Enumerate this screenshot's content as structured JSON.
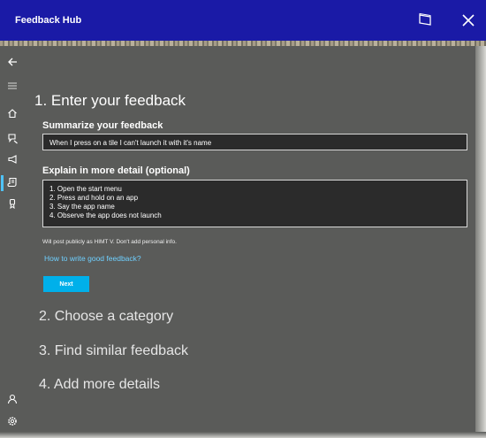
{
  "titlebar": {
    "app_title": "Feedback Hub"
  },
  "main": {
    "step1_heading": "1. Enter your feedback",
    "summary_label": "Summarize your feedback",
    "summary_value": "When I press on a tile I can't launch it with it's name",
    "details_label": "Explain in more detail (optional)",
    "details_lines": [
      "1. Open the start menu",
      "2. Press and hold on an app",
      "3. Say the app name",
      "4. Observe the app does not launch"
    ],
    "post_note": "Will post publicly as HIMT V. Don't add personal info.",
    "help_link": "How to write good feedback?",
    "next_label": "Next",
    "step2_heading": "2. Choose a category",
    "step3_heading": "3. Find similar feedback",
    "step4_heading": "4. Add more details"
  },
  "colors": {
    "titlebar": "#1a1aa6",
    "panel": "#5a5b59",
    "accent": "#00b0ea",
    "link": "#6fd0ff"
  },
  "icons": {
    "titlebar": [
      "mixed-reality-window-icon",
      "close-icon"
    ],
    "nav": [
      "back-arrow-icon",
      "hamburger-menu-icon",
      "home-icon",
      "feedback-icon",
      "announcements-icon",
      "quests-icon",
      "achievements-icon",
      "profile-icon",
      "settings-icon"
    ]
  }
}
